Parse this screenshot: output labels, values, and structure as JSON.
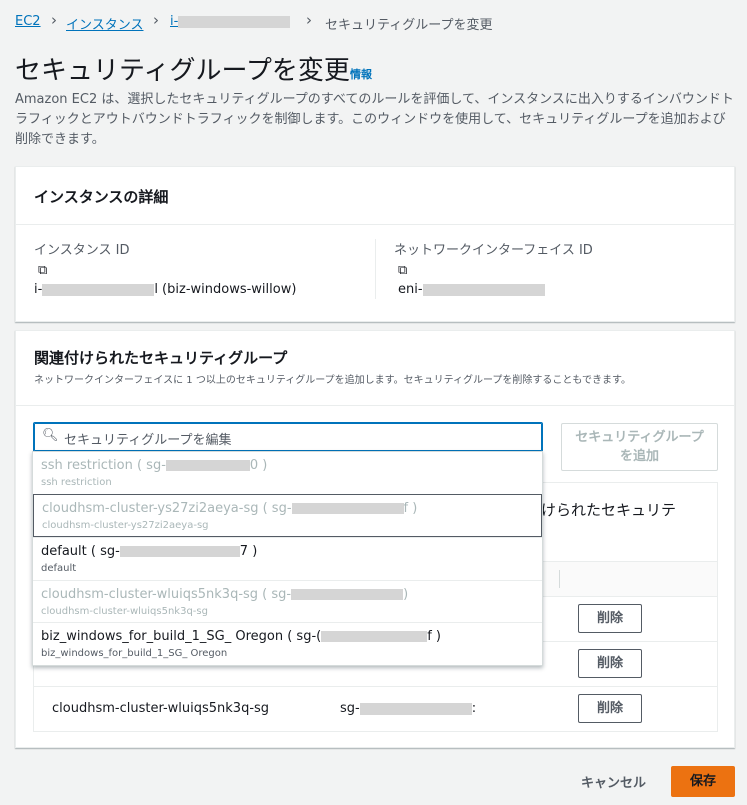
{
  "breadcrumb": {
    "ec2": "EC2",
    "instances": "インスタンス",
    "instance_prefix": "i-",
    "current": "セキュリティグループを変更"
  },
  "page": {
    "title": "セキュリティグループを変更",
    "info": "情報",
    "description": "Amazon EC2 は、選択したセキュリティグループのすべてのルールを評価して、インスタンスに出入りするインバウンドトラフィックとアウトバウンドトラフィックを制御します。このウィンドウを使用して、セキュリティグループを追加および削除できます。"
  },
  "instance_details": {
    "heading": "インスタンスの詳細",
    "instance_id_label": "インスタンス ID",
    "instance_id_prefix": "i-",
    "instance_id_suffix": "l (biz-windows-willow)",
    "eni_label": "ネットワークインターフェイス ID",
    "eni_prefix": "eni-"
  },
  "associated_groups": {
    "heading": "関連付けられたセキュリティグループ",
    "description": "ネットワークインターフェイスに 1 つ以上のセキュリティグループを追加します。セキュリティグループを削除することもできます。",
    "search_placeholder": "セキュリティグループを編集",
    "add_button": "セキュリティグループを追加",
    "hidden_heading_fragment": "けられたセキュリテ",
    "remove_label": "削除",
    "rows": [
      {
        "name": "",
        "id": ""
      },
      {
        "name": "",
        "id": ""
      },
      {
        "name": "cloudhsm-cluster-wluiqs5nk3q-sg",
        "id_prefix": "sg-",
        "id_suffix": ":"
      }
    ]
  },
  "dropdown": {
    "options": [
      {
        "title_prefix": "ssh restriction ( sg-",
        "title_suffix": "0 )",
        "subtitle": "ssh restriction",
        "disabled": true
      },
      {
        "title_prefix": "cloudhsm-cluster-ys27zi2aeya-sg ( sg-",
        "title_suffix": "f )",
        "subtitle": "cloudhsm-cluster-ys27zi2aeya-sg",
        "disabled": true
      },
      {
        "title_prefix": "default ( sg-",
        "title_suffix": "7 )",
        "subtitle": "default",
        "disabled": false
      },
      {
        "title_prefix": "cloudhsm-cluster-wluiqs5nk3q-sg ( sg-",
        "title_suffix": ")",
        "subtitle": "cloudhsm-cluster-wluiqs5nk3q-sg",
        "disabled": true
      },
      {
        "title_prefix": "biz_windows_for_build_1_SG_ Oregon ( sg-(",
        "title_suffix": "f )",
        "subtitle": "biz_windows_for_build_1_SG_ Oregon",
        "disabled": false
      }
    ]
  },
  "footer": {
    "cancel": "キャンセル",
    "save": "保存"
  },
  "colors": {
    "link": "#0073bb",
    "primary": "#ec7211",
    "focus": "#0073bb"
  }
}
